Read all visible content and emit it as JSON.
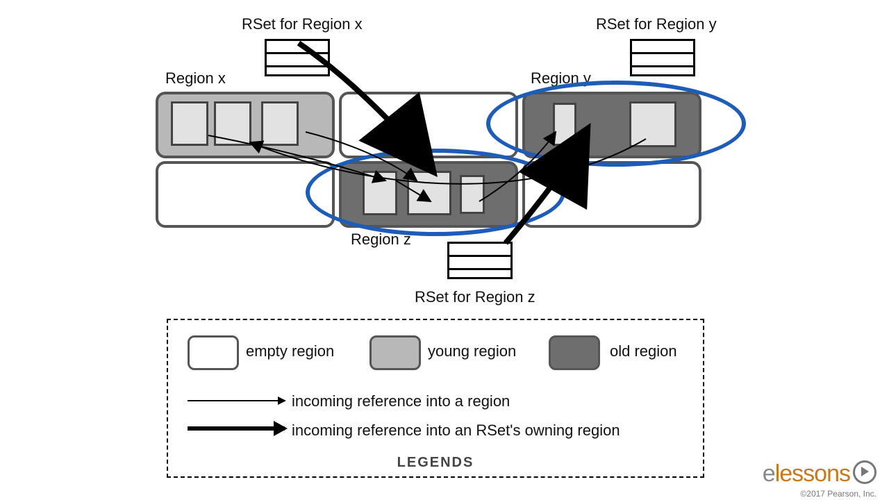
{
  "labels": {
    "rset_x": "RSet for Region x",
    "rset_y": "RSet for Region y",
    "rset_z": "RSet for Region z",
    "region_x": "Region x",
    "region_y": "Region y",
    "region_z": "Region z"
  },
  "legend": {
    "empty": "empty region",
    "young": "young region",
    "old": "old region",
    "ref_in": "incoming reference into a region",
    "ref_rset": "incoming reference into an RSet's owning region",
    "title": "LEGENDS"
  },
  "brand": {
    "name": "lessons",
    "prefix": "e",
    "copyright": "©2017 Pearson, Inc."
  }
}
